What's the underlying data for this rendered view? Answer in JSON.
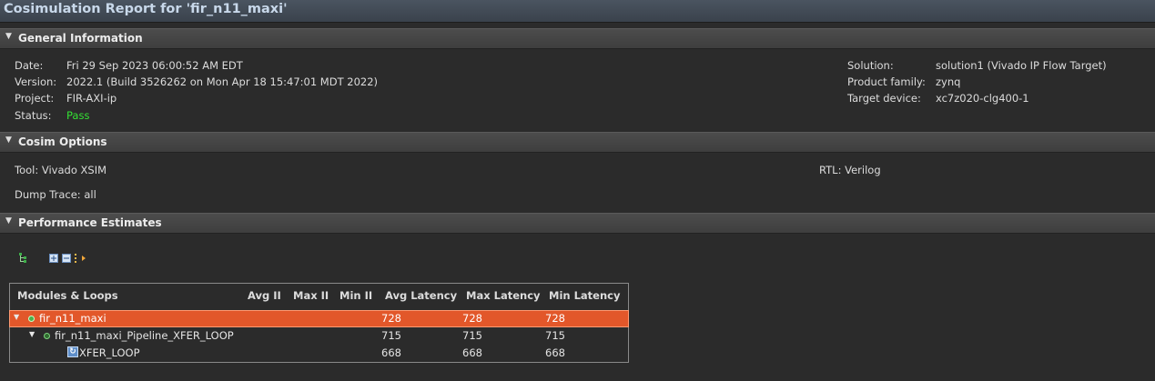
{
  "window": {
    "title": "Cosimulation Report for 'fir_n11_maxi'"
  },
  "sections": {
    "general": "General Information",
    "cosim": "Cosim Options",
    "perf": "Performance Estimates"
  },
  "general_info": {
    "date_label": "Date:",
    "date": "Fri 29 Sep 2023 06:00:52 AM EDT",
    "version_label": "Version:",
    "version": "2022.1 (Build 3526262 on Mon Apr 18 15:47:01 MDT 2022)",
    "project_label": "Project:",
    "project": "FIR-AXI-ip",
    "status_label": "Status:",
    "status": "Pass",
    "solution_label": "Solution:",
    "solution": "solution1 (Vivado IP Flow Target)",
    "family_label": "Product family:",
    "family": "zynq",
    "device_label": "Target device:",
    "device": "xc7z020-clg400-1"
  },
  "cosim_options": {
    "tool": "Tool: Vivado XSIM",
    "rtl": "RTL: Verilog",
    "dump": "Dump Trace: all"
  },
  "table": {
    "headers": [
      "Modules & Loops",
      "Avg II",
      "Max II",
      "Min II",
      "Avg Latency",
      "Max Latency",
      "Min Latency"
    ],
    "rows": [
      {
        "name": "fir_n11_maxi",
        "avg_ii": "",
        "max_ii": "",
        "min_ii": "",
        "avg_lat": "728",
        "max_lat": "728",
        "min_lat": "728"
      },
      {
        "name": "fir_n11_maxi_Pipeline_XFER_LOOP",
        "avg_ii": "",
        "max_ii": "",
        "min_ii": "",
        "avg_lat": "715",
        "max_lat": "715",
        "min_lat": "715"
      },
      {
        "name": "XFER_LOOP",
        "avg_ii": "",
        "max_ii": "",
        "min_ii": "",
        "avg_lat": "668",
        "max_lat": "668",
        "min_lat": "668"
      }
    ]
  },
  "icons": {
    "toolbar": [
      "hierarchy-icon",
      "expand-all-icon",
      "collapse-all-icon",
      "export-icon"
    ],
    "module": "module-status-icon",
    "loop": "loop-icon"
  },
  "colors": {
    "selected_row": "#e2572a",
    "pass": "#34e034",
    "title": "#c8d8ea"
  }
}
